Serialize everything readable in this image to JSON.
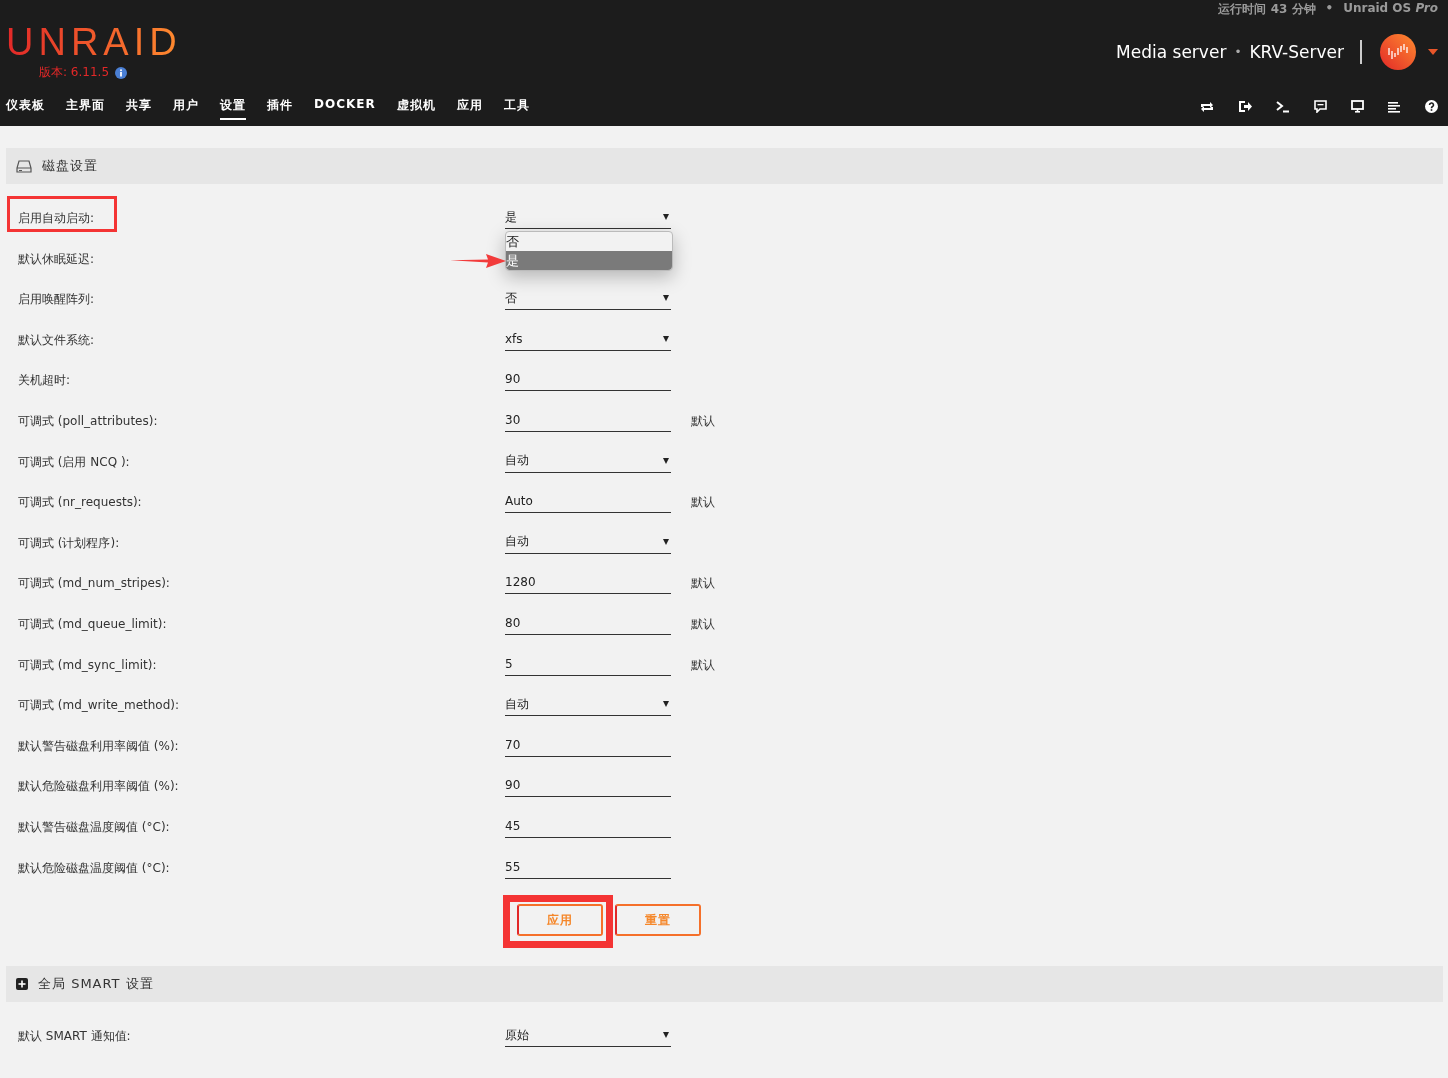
{
  "header": {
    "logo": "UNRAID",
    "version": "版本: 6.11.5",
    "uptime": "运行时间 43 分钟",
    "separator": "•",
    "license": "Unraid OS *Pro*",
    "server_description": "Media server",
    "server_separator": "•",
    "server_name": "KRV-Server"
  },
  "nav": [
    {
      "label": "仪表板",
      "selected": false
    },
    {
      "label": "主界面",
      "selected": false
    },
    {
      "label": "共享",
      "selected": false
    },
    {
      "label": "用户",
      "selected": false
    },
    {
      "label": "设置",
      "selected": true
    },
    {
      "label": "插件",
      "selected": false
    },
    {
      "label": "DOCKER",
      "selected": false
    },
    {
      "label": "虚拟机",
      "selected": false
    },
    {
      "label": "应用",
      "selected": false
    },
    {
      "label": "工具",
      "selected": false
    }
  ],
  "sections": [
    {
      "title": "磁盘设置",
      "collapsed": false,
      "rows": [
        {
          "label": "启用自动启动:",
          "kind": "select",
          "value": "是",
          "highlighted": true,
          "open_options": [
            {
              "label": "否",
              "selected": false,
              "pointed": false
            },
            {
              "label": "是",
              "selected": true,
              "pointed": true
            }
          ]
        },
        {
          "label": "默认休眠延迟:",
          "kind": "hidden"
        },
        {
          "label": "启用唤醒阵列:",
          "kind": "select",
          "value": "否"
        },
        {
          "label": "默认文件系统:",
          "kind": "select",
          "value": "xfs"
        },
        {
          "label": "关机超时:",
          "kind": "input",
          "value": "90"
        },
        {
          "label": "可调式 (poll_attributes):",
          "kind": "input",
          "value": "30",
          "default": "默认"
        },
        {
          "label": "可调式 (启用 NCQ ):",
          "kind": "select",
          "value": "自动"
        },
        {
          "label": "可调式 (nr_requests):",
          "kind": "input",
          "value": "Auto",
          "default": "默认"
        },
        {
          "label": "可调式 (计划程序):",
          "kind": "select",
          "value": "自动"
        },
        {
          "label": "可调式 (md_num_stripes):",
          "kind": "input",
          "value": "1280",
          "default": "默认"
        },
        {
          "label": "可调式 (md_queue_limit):",
          "kind": "input",
          "value": "80",
          "default": "默认"
        },
        {
          "label": "可调式 (md_sync_limit):",
          "kind": "input",
          "value": "5",
          "default": "默认"
        },
        {
          "label": "可调式 (md_write_method):",
          "kind": "select",
          "value": "自动"
        },
        {
          "label": "默认警告磁盘利用率阈值 (%):",
          "kind": "input",
          "value": "70"
        },
        {
          "label": "默认危险磁盘利用率阈值 (%):",
          "kind": "input",
          "value": "90"
        },
        {
          "label": "默认警告磁盘温度阈值 (°C):",
          "kind": "input",
          "value": "45"
        },
        {
          "label": "默认危险磁盘温度阈值 (°C):",
          "kind": "input",
          "value": "55"
        }
      ],
      "buttons": [
        {
          "label": "应用",
          "highlighted": true
        },
        {
          "label": "重置",
          "highlighted": false
        }
      ]
    },
    {
      "title": "全局 SMART 设置",
      "collapsed": true,
      "rows": [
        {
          "label": "默认 SMART 通知值:",
          "kind": "select",
          "value": "原始"
        }
      ]
    }
  ]
}
